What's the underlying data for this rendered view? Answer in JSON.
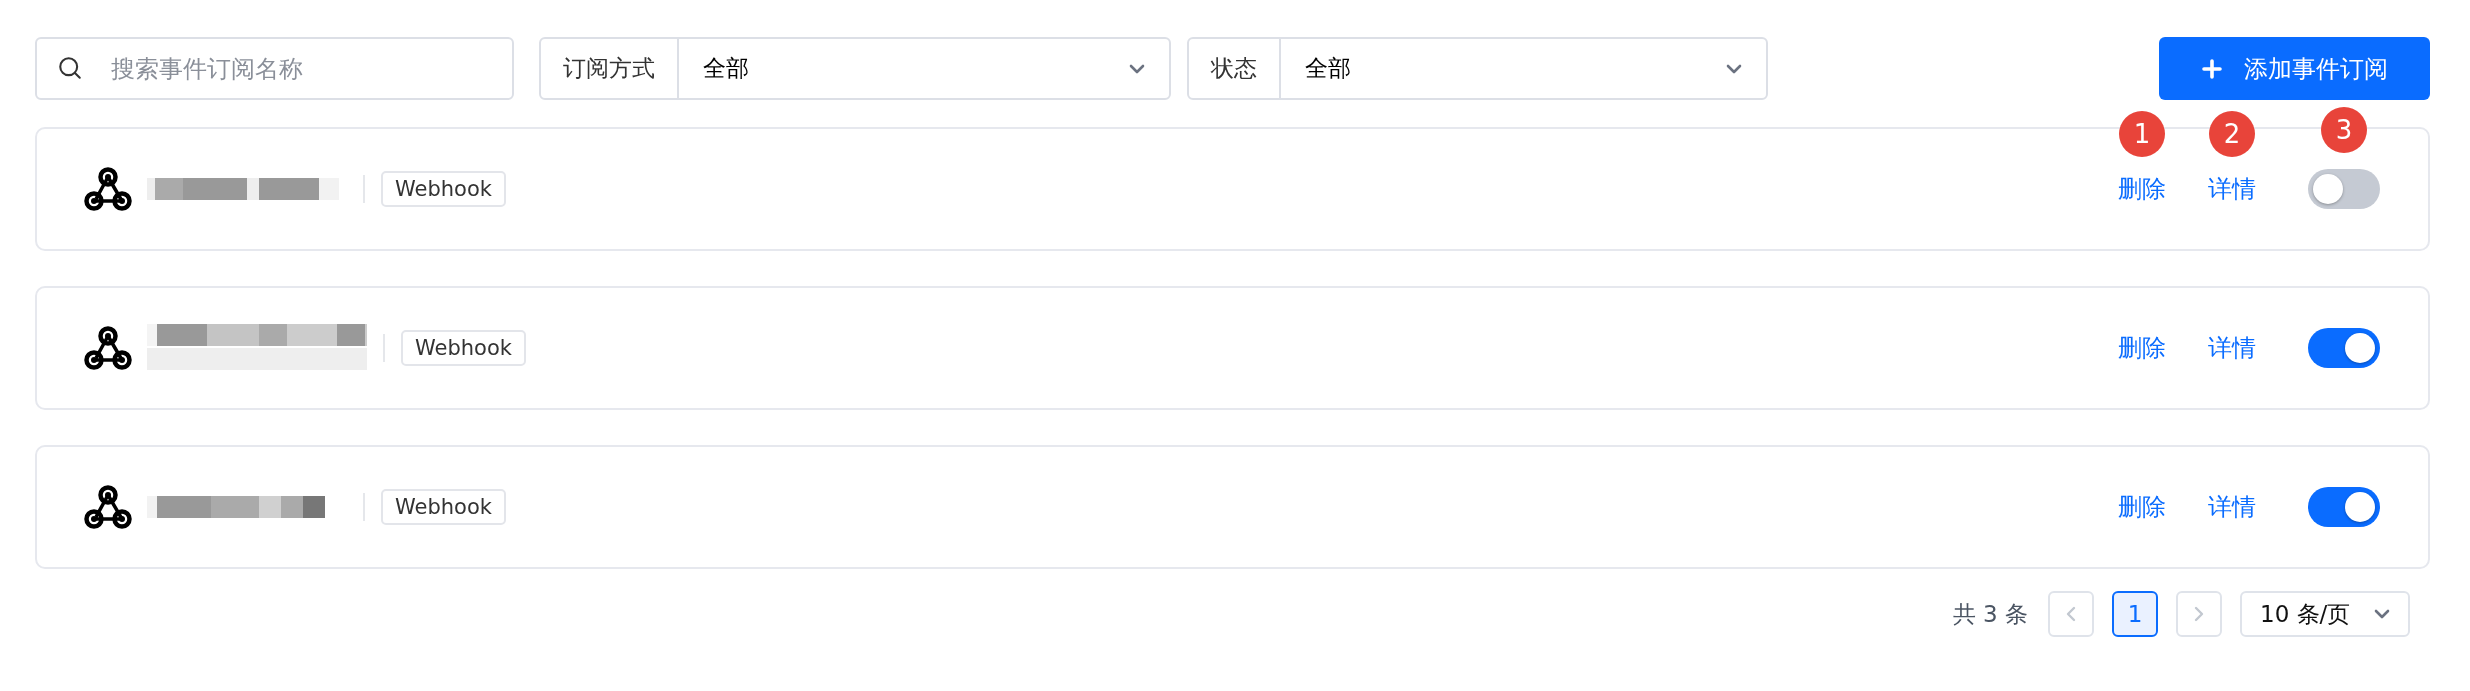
{
  "search": {
    "placeholder": "搜索事件订阅名称"
  },
  "filters": [
    {
      "label": "订阅方式",
      "value": "全部"
    },
    {
      "label": "状态",
      "value": "全部"
    }
  ],
  "add_button": {
    "label": "添加事件订阅"
  },
  "subscriptions": [
    {
      "type": "Webhook",
      "actions": [
        "删除",
        "详情"
      ],
      "on": false
    },
    {
      "type": "Webhook",
      "actions": [
        "删除",
        "详情"
      ],
      "on": true
    },
    {
      "type": "Webhook",
      "actions": [
        "删除",
        "详情"
      ],
      "on": true
    }
  ],
  "callouts": [
    "1",
    "2",
    "3"
  ],
  "pagination": {
    "total": "共 3 条",
    "pages": [
      {
        "label": "1",
        "selected": true
      }
    ],
    "page_size": "10 条/页"
  }
}
